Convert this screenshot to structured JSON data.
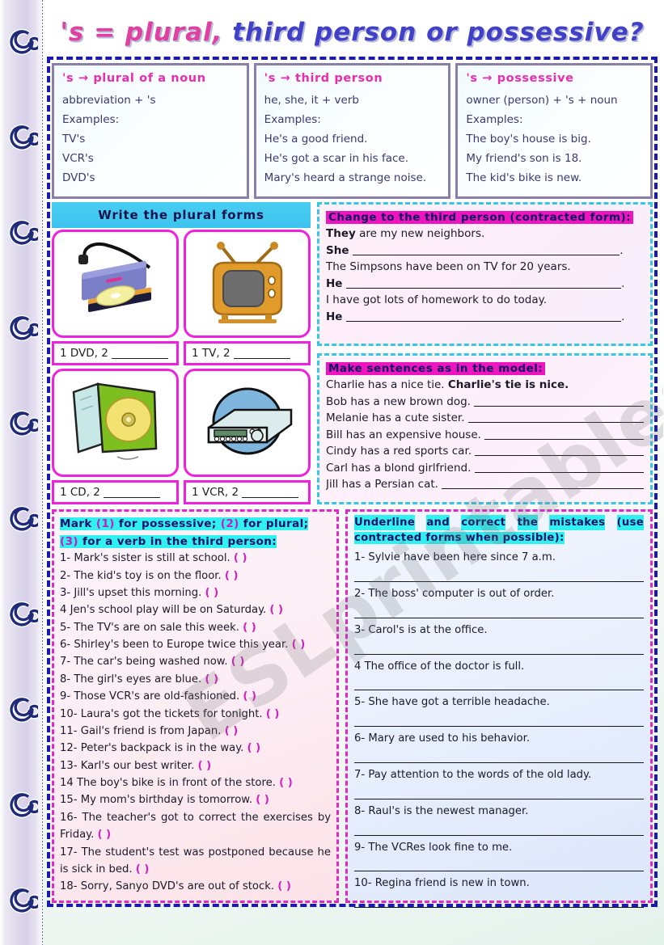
{
  "title": {
    "segments": [
      {
        "t": "'s = ",
        "c": "pk"
      },
      {
        "t": "plural, ",
        "c": "pk"
      },
      {
        "t": "third person or possessive?",
        "c": "bl"
      }
    ],
    "full": "'s = plural, third person or possessive?"
  },
  "watermark": "ESLprintables.com",
  "colors": {
    "border_blue": "#1a1ab0",
    "magenta": "#ee2bb0",
    "cyan": "#30f0f0",
    "highlight_magenta": "#ee15c0",
    "pic_border": "#f020e0",
    "header_cyan": "#3dc3ee"
  },
  "definitions": [
    {
      "header": "'s → plural of a noun",
      "lines": [
        "abbreviation + 's",
        "Examples:",
        "TV's",
        "VCR's",
        "DVD's"
      ]
    },
    {
      "header": "'s → third person",
      "lines": [
        "he, she, it + verb",
        "Examples:",
        "He's a good friend.",
        "He's got a scar in his face.",
        "Mary's heard a strange noise."
      ]
    },
    {
      "header": "'s → possessive",
      "lines": [
        "owner (person) + 's + noun",
        "Examples:",
        "The boy's house is big.",
        "My friend's son is 18.",
        "The kid's bike is new."
      ]
    }
  ],
  "plural_section": {
    "header": "Write the plural forms",
    "items": [
      {
        "icon": "dvd-drive-image",
        "label_prefix": "1 DVD, 2"
      },
      {
        "icon": "television-image",
        "label_prefix": "1 TV, 2"
      },
      {
        "icon": "cd-case-image",
        "label_prefix": "1 CD, 2"
      },
      {
        "icon": "vcr-image",
        "label_prefix": "1 VCR, 2"
      }
    ]
  },
  "third_person": {
    "header": "Change to the third person (contracted form):",
    "pairs": [
      {
        "prompt_bold": "They",
        "prompt_rest": " are my new neighbors.",
        "answer_lead": "She"
      },
      {
        "prompt_bold": "",
        "prompt_rest": "The Simpsons have been on TV for 20 years.",
        "answer_lead": "He"
      },
      {
        "prompt_bold": "",
        "prompt_rest": "I have got lots of homework to do today.",
        "answer_lead": "He"
      }
    ]
  },
  "model_section": {
    "header": "Make sentences as in the model:",
    "example_prompt": "Charlie has a nice tie.",
    "example_answer": "Charlie's tie is nice.",
    "items": [
      "Bob has a new brown dog.",
      "Melanie has a cute sister.",
      "Bill has an expensive house.",
      "Cindy has a red sports car.",
      "Carl has a blond girlfriend.",
      "Jill has a Persian cat."
    ]
  },
  "mark_section": {
    "header_parts": [
      {
        "t": "Mark ",
        "k": "n"
      },
      {
        "t": "(1)",
        "k": "num"
      },
      {
        "t": " for possessive; ",
        "k": "n"
      },
      {
        "t": "(2)",
        "k": "num"
      },
      {
        "t": " for plural; ",
        "k": "n"
      },
      {
        "t": "(3)",
        "k": "num"
      },
      {
        "t": " for a verb in the third person:",
        "k": "n"
      }
    ],
    "items": [
      "1- Mark's sister is still at school.",
      "2- The kid's toy is on the floor.",
      "3- Jill's upset this morning.",
      "4 Jen's school play will be on Saturday.",
      "5- The TV's are on sale this week.",
      "6- Shirley's been to Europe twice this year.",
      "7- The car's being washed now.",
      "8- The girl's eyes are blue.",
      "9- Those VCR's are old-fashioned.",
      "10- Laura's got the tickets for tonight.",
      "11- Gail's friend is from Japan.",
      "12- Peter's backpack is in the way.",
      "13- Karl's our best writer.",
      "14 The boy's bike is in front of the store.",
      "15- My mom's birthday is tomorrow.",
      "16- The teacher's got to correct the exercises by Friday.",
      "17- The student's test was postponed because he is sick in bed.",
      "18- Sorry, Sanyo DVD's are out of stock."
    ],
    "answer_marker": "( )"
  },
  "correct_section": {
    "header_line1": "Underline    and    correct    the    mistakes    (use",
    "header_line2": "contracted forms when possible):",
    "items": [
      "1- Sylvie have been here since 7 a.m.",
      "2- The boss' computer is out of order.",
      "3- Carol's is at the office.",
      "4 The office of the doctor is full.",
      "5- She have got a terrible headache.",
      "6- Mary are used to his behavior.",
      "7- Pay attention to the words of the old lady.",
      "8- Raul's is the newest manager.",
      "9- The VCRes look fine to me.",
      "10- Regina friend is new in town."
    ]
  }
}
